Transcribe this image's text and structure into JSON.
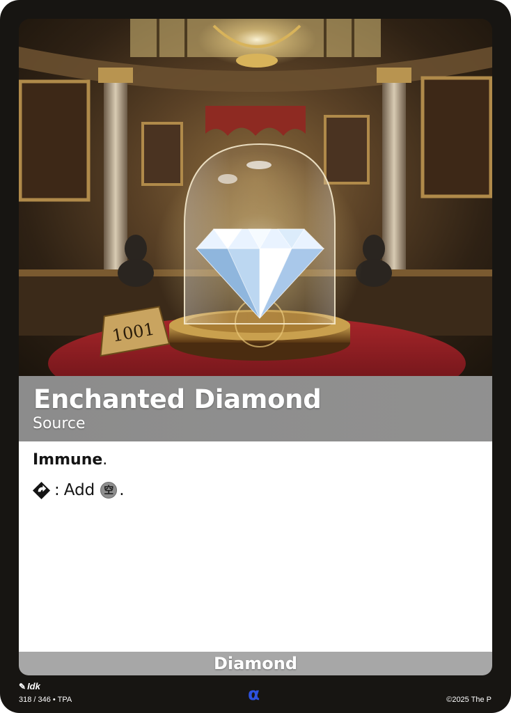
{
  "card": {
    "name": "Enchanted Diamond",
    "type_line": "Source",
    "rules": {
      "keyword": "Immune",
      "keyword_punct": ".",
      "ability_cost_icon": "tap-diamond-icon",
      "ability_colon": ":",
      "ability_text": "Add",
      "mana_symbol_glyph": "空",
      "ability_end": "."
    },
    "subtype": "Diamond",
    "plaque_text": "1001"
  },
  "footer": {
    "artist_icon": "brush-icon",
    "artist": "Idk",
    "collector": "318 / 346 • TPA",
    "set_symbol": "α",
    "copyright": "©2025 The P"
  },
  "colors": {
    "card_border": "#171512",
    "title_band": "#9a9a9a",
    "subtype_bar": "#a7a7a7",
    "set_symbol": "#2d52e0"
  }
}
